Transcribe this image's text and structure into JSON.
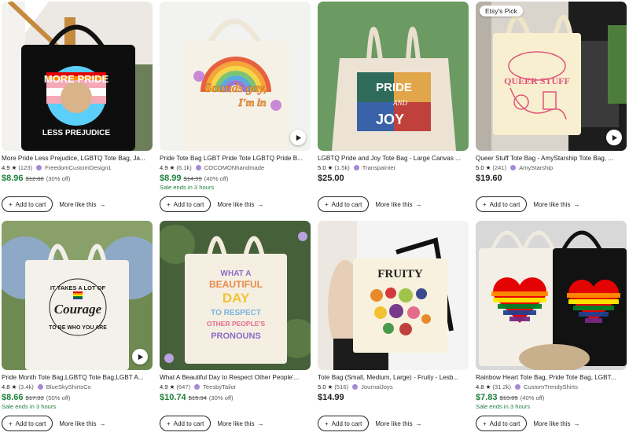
{
  "labels": {
    "add_to_cart": "Add to cart",
    "more_like_this": "More like this",
    "etsys_pick": "Etsy's Pick"
  },
  "colors": {
    "sale_green": "#1d7f3a",
    "shop_badge": "#a788d8"
  },
  "products": [
    {
      "title": "More Pride Less Prejudice, LGBTQ Tote Bag, Ja...",
      "rating": "4.9",
      "reviews": "(123)",
      "shop": "FreedomCustomDesign1",
      "price": "$8.96",
      "orig_price": "$12.80",
      "discount": "(30% off)",
      "sale_ends": "",
      "image_text": [
        "MORE PRIDE",
        "LESS PREJUDICE"
      ],
      "icons": [
        "plus-icon",
        "arrow-right-icon"
      ]
    },
    {
      "title": "Pride Tote Bag LGBT Pride Tote LGBTQ Pride B...",
      "rating": "4.9",
      "reviews": "(6.1k)",
      "shop": "COCOMONhandmade",
      "price": "$8.99",
      "orig_price": "$14.99",
      "discount": "(40% off)",
      "sale_ends": "Sale ends in 3 hours",
      "image_text": [
        "Sounds gay,",
        "I'm in"
      ]
    },
    {
      "title": "LGBTQ Pride and Joy Tote Bag - Large Canvas ...",
      "rating": "5.0",
      "reviews": "(1.5k)",
      "shop": "Transpainter",
      "price": "$25.00",
      "orig_price": "",
      "discount": "",
      "sale_ends": "",
      "image_text": [
        "PRIDE",
        "AND",
        "JOY"
      ]
    },
    {
      "title": "Queer Stuff Tote Bag - AmyStarship Tote Bag, ...",
      "rating": "5.0",
      "reviews": "(241)",
      "shop": "AmyStarship",
      "price": "$19.60",
      "orig_price": "",
      "discount": "",
      "sale_ends": "",
      "image_text": [
        "QUEER STUFF"
      ]
    },
    {
      "title": "Pride Month Tote Bag,LGBTQ Tote Bag,LGBT A...",
      "rating": "4.8",
      "reviews": "(3.4k)",
      "shop": "BlueSkyShirtsCo",
      "price": "$8.66",
      "orig_price": "$17.33",
      "discount": "(50% off)",
      "sale_ends": "Sale ends in 3 hours",
      "image_text": [
        "IT TAKES A LOT OF",
        "Courage",
        "TO BE WHO YOU ARE"
      ]
    },
    {
      "title": "What A Beautiful Day to Respect Other People'...",
      "rating": "4.9",
      "reviews": "(647)",
      "shop": "TeesbyTailor",
      "price": "$10.74",
      "orig_price": "$15.34",
      "discount": "(30% off)",
      "sale_ends": "",
      "image_text": [
        "WHAT A",
        "BEAUTIFUL",
        "DAY",
        "TO RESPECT",
        "OTHER PEOPLE'S",
        "PRONOUNS"
      ]
    },
    {
      "title": "Tote Bag (Small, Medium, Large) - Fruity - Lesb...",
      "rating": "5.0",
      "reviews": "(516)",
      "shop": "JournalJoys",
      "price": "$14.99",
      "orig_price": "",
      "discount": "",
      "sale_ends": "",
      "image_text": [
        "FRUITY"
      ]
    },
    {
      "title": "Rainbow Heart Tote Bag, Pride Tote Bag, LGBT...",
      "rating": "4.8",
      "reviews": "(31.2k)",
      "shop": "CustomTrendyShirts",
      "price": "$7.83",
      "orig_price": "$13.05",
      "discount": "(40% off)",
      "sale_ends": "Sale ends in 3 hours",
      "image_text": []
    }
  ]
}
